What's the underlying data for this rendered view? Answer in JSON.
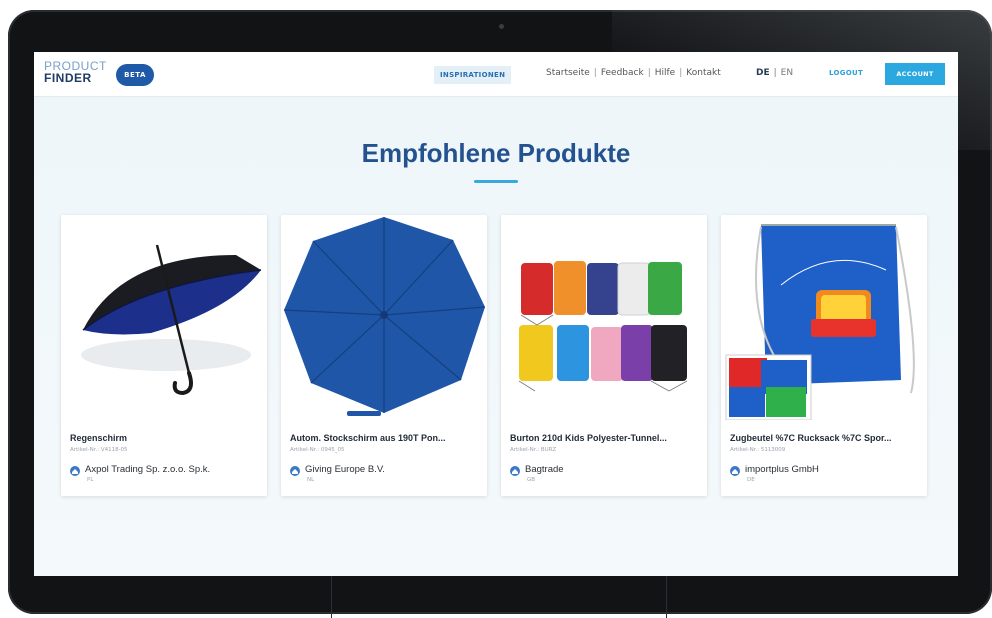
{
  "header": {
    "logo_line1": "PRODUCT",
    "logo_line2": "FINDER",
    "badge": "BETA",
    "inspirations": "INSPIRATIONEN",
    "links": [
      "Startseite",
      "Feedback",
      "Hilfe",
      "Kontakt"
    ],
    "lang_de": "DE",
    "lang_en": "EN",
    "logout": "LOGOUT",
    "account": "ACCOUNT"
  },
  "main": {
    "heading": "Empfohlene Produkte",
    "products": [
      {
        "title": "Regenschirm",
        "article": "Artikel-Nr.: V4118-05",
        "supplier": "Axpol Trading Sp. z.o.o. Sp.k.",
        "country": "PL"
      },
      {
        "title": "Autom. Stockschirm aus 190T Pon...",
        "article": "Artikel-Nr.: 0945_05",
        "supplier": "Giving Europe B.V.",
        "country": "NL"
      },
      {
        "title": "Burton 210d Kids Polyester-Tunnel...",
        "article": "Artikel-Nr.: BURZ",
        "supplier": "Bagtrade",
        "country": "GB"
      },
      {
        "title": "Zugbeutel %7C Rucksack %7C Spor...",
        "article": "Artikel-Nr.: 5113009",
        "supplier": "importplus GmbH",
        "country": "DE"
      }
    ]
  },
  "colors": {
    "brand_blue": "#24528f",
    "accent": "#2aa8df",
    "logo_badge": "#1e5aa8"
  }
}
